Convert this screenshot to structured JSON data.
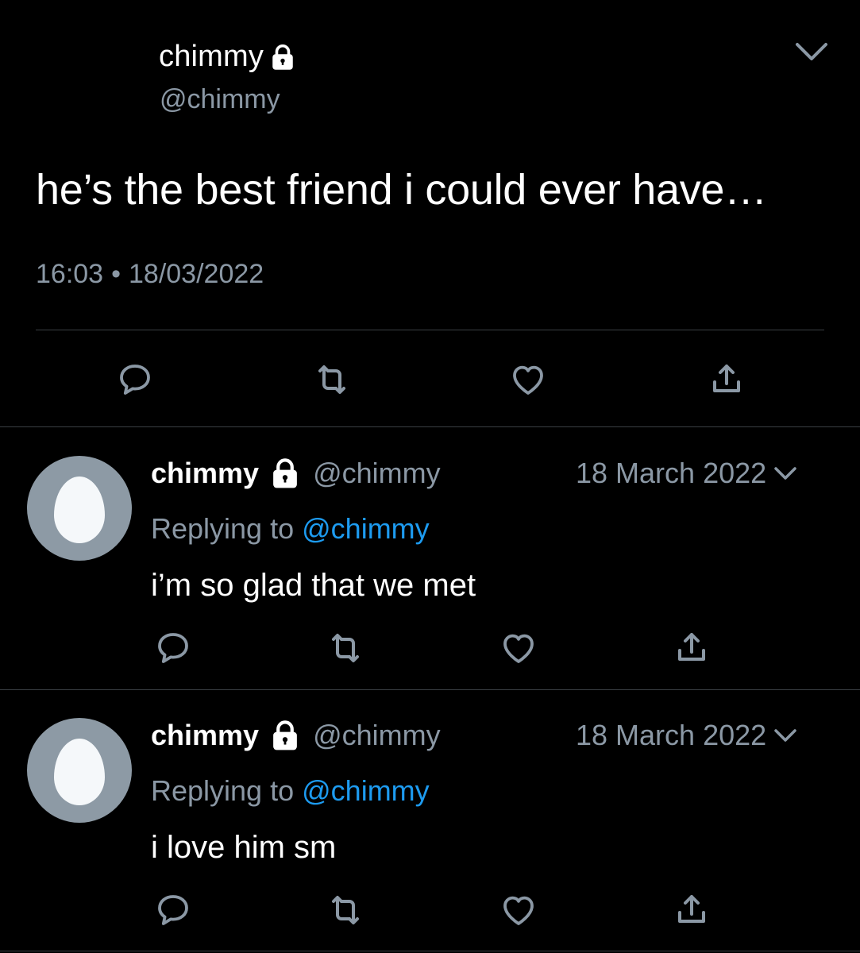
{
  "main_tweet": {
    "author_name": "chimmy",
    "author_handle": "@chimmy",
    "text": "he’s the best friend i could ever have…",
    "time": "16:03",
    "separator": "•",
    "date": "18/03/2022",
    "icons": [
      "lock-icon",
      "chevron-down-icon",
      "reply-icon",
      "retweet-icon",
      "like-icon",
      "share-icon"
    ]
  },
  "replies": [
    {
      "author_name": "chimmy",
      "author_handle": "@chimmy",
      "date": "18 March 2022",
      "replying_prefix": "Replying to",
      "replying_to": "@chimmy",
      "text": "i’m so glad that we met"
    },
    {
      "author_name": "chimmy",
      "author_handle": "@chimmy",
      "date": "18 March 2022",
      "replying_prefix": "Replying to",
      "replying_to": "@chimmy",
      "text": "i love him sm"
    }
  ],
  "colors": {
    "background": "#000000",
    "primary_text": "#ffffff",
    "secondary_text": "#8b98a5",
    "link": "#1d9bf0",
    "divider": "#3a3f44",
    "avatar_bg": "#8d9aa5"
  }
}
